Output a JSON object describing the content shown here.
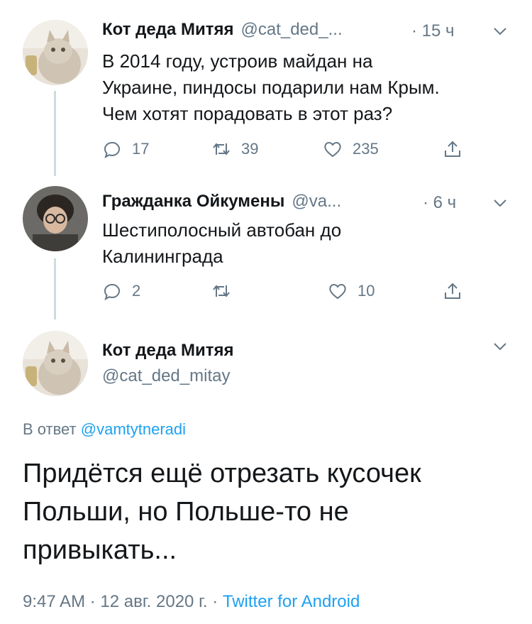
{
  "tweets": [
    {
      "name": "Кот деда Митяя",
      "handle": "@cat_ded_...",
      "time": "· 15 ч",
      "text_lines": [
        "В 2014 году, устроив майдан на",
        "Украине, пиндосы подарили нам Крым.",
        "Чем хотят порадовать в этот раз?"
      ],
      "replies": "17",
      "retweets": "39",
      "likes": "235"
    },
    {
      "name": "Гражданка Ойкумены",
      "handle": "@va...",
      "time": "· 6 ч",
      "text_lines": [
        "Шестиполосный автобан до",
        "Калининграда"
      ],
      "replies": "2",
      "retweets": "",
      "likes": "10"
    }
  ],
  "main": {
    "name": "Кот деда Митяя",
    "handle": "@cat_ded_mitay",
    "reply_prefix": "В ответ",
    "reply_mention": "@vamtytneradi",
    "text_lines": [
      "Придётся ещё отрезать кусочек",
      "Польши, но Польше-то не",
      "привыкать..."
    ],
    "timestamp": "9:47 AM · 12 авг. 2020 г. ·",
    "source": "Twitter for Android"
  },
  "colors": {
    "link": "#1da1f2",
    "secondary": "#657786",
    "text": "#14171a",
    "thread_line": "#cfd9de"
  }
}
